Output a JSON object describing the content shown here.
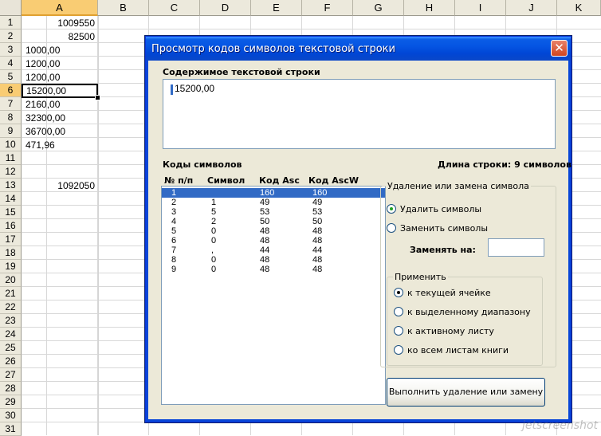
{
  "spreadsheet": {
    "columns": [
      "A",
      "B",
      "C",
      "D",
      "E",
      "F",
      "G",
      "H",
      "I",
      "J",
      "K"
    ],
    "rows": [
      "1",
      "2",
      "3",
      "4",
      "5",
      "6",
      "7",
      "8",
      "9",
      "10",
      "11",
      "12",
      "13",
      "14",
      "15",
      "16",
      "17",
      "18",
      "19",
      "20",
      "21",
      "22",
      "23",
      "24",
      "25",
      "26",
      "27",
      "28",
      "29",
      "30",
      "31"
    ],
    "cells": [
      {
        "text": "1009550",
        "align": "right"
      },
      {
        "text": "82500",
        "align": "right"
      },
      {
        "text": "1000,00",
        "align": "left"
      },
      {
        "text": "1200,00",
        "align": "left"
      },
      {
        "text": "1200,00",
        "align": "left"
      },
      {
        "text": "15200,00",
        "align": "left"
      },
      {
        "text": "2160,00",
        "align": "left"
      },
      {
        "text": "32300,00",
        "align": "left"
      },
      {
        "text": "36700,00",
        "align": "left"
      },
      {
        "text": "471,96",
        "align": "left"
      },
      {
        "text": "",
        "align": "left"
      },
      {
        "text": "",
        "align": "left"
      },
      {
        "text": "1092050",
        "align": "right"
      }
    ],
    "selected_column": "A",
    "selected_row": "6",
    "accent_color": "#f9cc73"
  },
  "dialog": {
    "title": "Просмотр кодов символов текстовой строки",
    "close_icon": "close-icon",
    "content_label": "Содержимое текстовой строки",
    "content_value": "15200,00",
    "codes_label": "Коды символов",
    "length_label": "Длина строки: 9 символов",
    "list": {
      "headers": [
        "№ п/п",
        "Символ",
        "Код Asc",
        "Код AscW"
      ],
      "rows": [
        {
          "n": "1",
          "sym": "",
          "asc": "160",
          "ascw": "160"
        },
        {
          "n": "2",
          "sym": "1",
          "asc": "49",
          "ascw": "49"
        },
        {
          "n": "3",
          "sym": "5",
          "asc": "53",
          "ascw": "53"
        },
        {
          "n": "4",
          "sym": "2",
          "asc": "50",
          "ascw": "50"
        },
        {
          "n": "5",
          "sym": "0",
          "asc": "48",
          "ascw": "48"
        },
        {
          "n": "6",
          "sym": "0",
          "asc": "48",
          "ascw": "48"
        },
        {
          "n": "7",
          "sym": ",",
          "asc": "44",
          "ascw": "44"
        },
        {
          "n": "8",
          "sym": "0",
          "asc": "48",
          "ascw": "48"
        },
        {
          "n": "9",
          "sym": "0",
          "asc": "48",
          "ascw": "48"
        }
      ],
      "selected_index": 0
    },
    "mode_group": {
      "title": "Удаление или замена символа",
      "delete_label": "Удалить символы",
      "replace_label": "Заменить символы",
      "selected": "delete",
      "replace_with_label": "Заменять на:",
      "replace_with_value": ""
    },
    "apply_group": {
      "title": "Применить",
      "options": [
        "к текущей ячейке",
        "к выделенному диапазону",
        "к активному листу",
        "ко всем листам книги"
      ],
      "selected": 0
    },
    "execute_button": "Выполнить удаление или замену"
  },
  "watermark": "jetscreenshot"
}
